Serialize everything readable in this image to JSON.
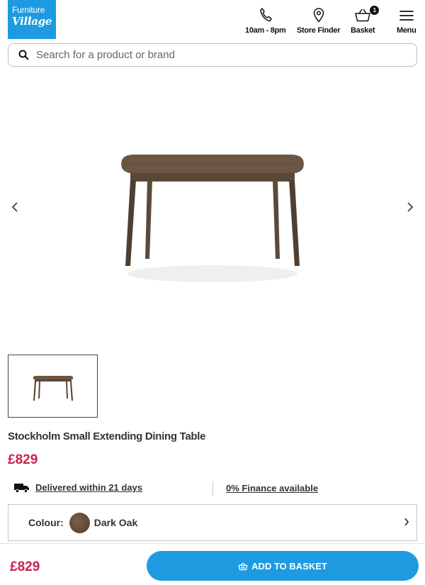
{
  "brand": {
    "line1": "Furniture",
    "line2": "Village"
  },
  "header": {
    "hours_label": "10am - 8pm",
    "store_label": "Store Finder",
    "basket_label": "Basket",
    "basket_count": "1",
    "menu_label": "Menu"
  },
  "search": {
    "placeholder": "Search for a product or brand"
  },
  "product": {
    "title": "Stockholm Small Extending Dining Table",
    "price": "£829",
    "delivery": "Delivered within 21 days",
    "finance": "0% Finance available",
    "colour_label": "Colour:",
    "colour_value": "Dark Oak",
    "colour_hex": "#6b513a"
  },
  "footer": {
    "price": "£829",
    "add_label": "ADD TO BASKET"
  },
  "colors": {
    "brand_blue": "#1e9be0",
    "price_red": "#c8244d"
  }
}
